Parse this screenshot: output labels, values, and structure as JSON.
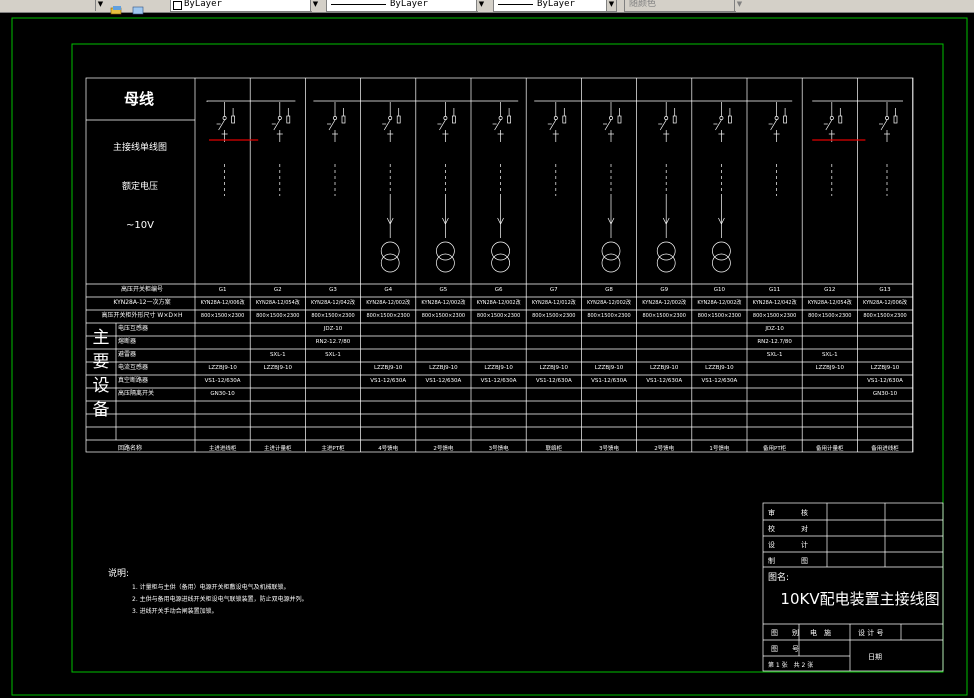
{
  "toolbar": {
    "dropdowns": [
      {
        "value": "ByLayer"
      },
      {
        "value": "ByLayer"
      },
      {
        "value": "ByLayer"
      },
      {
        "value": "随颜色"
      }
    ]
  },
  "drawing": {
    "busbar_title": "母线",
    "left_labels": {
      "diagram": "主接线单线图",
      "voltage_label": "额定电压",
      "voltage_value": "~10V"
    },
    "row_headers": {
      "cabinet_no": "高压开关柜编号",
      "cabinet_type": "KYN28A-12一次方案",
      "dims": "高压开关柜外形尺寸 W×D×H",
      "purpose": "回路名称"
    },
    "main_equipment_label": [
      "主",
      "要",
      "设",
      "备"
    ],
    "equipment_rows": [
      "电压互感器",
      "熔断器",
      "避雷器",
      "电流互感器",
      "真空断路器",
      "高压隔离开关"
    ],
    "columns": [
      {
        "no": "G1",
        "type": "KYN28A-12/006改",
        "dims": "800×1500×2300",
        "vt": "",
        "fuse": "",
        "arrester": "",
        "ct": "LZZBJ9-10",
        "breaker": "VS1-12/630A",
        "switch": "GN30-10",
        "purpose": "主进进线柜",
        "xformer": false
      },
      {
        "no": "G2",
        "type": "KYN28A-12/054改",
        "dims": "800×1500×2300",
        "vt": "",
        "fuse": "",
        "arrester": "SXL-1",
        "ct": "LZZBJ9-10",
        "breaker": "",
        "switch": "",
        "purpose": "主进计量柜",
        "xformer": false
      },
      {
        "no": "G3",
        "type": "KYN28A-12/042改",
        "dims": "800×1500×2300",
        "vt": "JDZ-10",
        "fuse": "RN2-12.7/80",
        "arrester": "SXL-1",
        "ct": "",
        "breaker": "",
        "switch": "",
        "purpose": "主进PT柜",
        "xformer": false
      },
      {
        "no": "G4",
        "type": "KYN28A-12/002改",
        "dims": "800×1500×2300",
        "vt": "",
        "fuse": "",
        "arrester": "",
        "ct": "LZZBJ9-10",
        "breaker": "VS1-12/630A",
        "switch": "",
        "purpose": "4号馈电",
        "xformer": true
      },
      {
        "no": "G5",
        "type": "KYN28A-12/002改",
        "dims": "800×1500×2300",
        "vt": "",
        "fuse": "",
        "arrester": "",
        "ct": "LZZBJ9-10",
        "breaker": "VS1-12/630A",
        "switch": "",
        "purpose": "2号馈电",
        "xformer": true
      },
      {
        "no": "G6",
        "type": "KYN28A-12/002改",
        "dims": "800×1500×2300",
        "vt": "",
        "fuse": "",
        "arrester": "",
        "ct": "LZZBJ9-10",
        "breaker": "VS1-12/630A",
        "switch": "",
        "purpose": "3号馈电",
        "xformer": true
      },
      {
        "no": "G7",
        "type": "KYN28A-12/012改",
        "dims": "800×1500×2300",
        "vt": "",
        "fuse": "",
        "arrester": "",
        "ct": "LZZBJ9-10",
        "breaker": "VS1-12/630A",
        "switch": "",
        "purpose": "联络柜",
        "xformer": false
      },
      {
        "no": "G8",
        "type": "KYN28A-12/002改",
        "dims": "800×1500×2300",
        "vt": "",
        "fuse": "",
        "arrester": "",
        "ct": "LZZBJ9-10",
        "breaker": "VS1-12/630A",
        "switch": "",
        "purpose": "3号馈电",
        "xformer": true
      },
      {
        "no": "G9",
        "type": "KYN28A-12/002改",
        "dims": "800×1500×2300",
        "vt": "",
        "fuse": "",
        "arrester": "",
        "ct": "LZZBJ9-10",
        "breaker": "VS1-12/630A",
        "switch": "",
        "purpose": "2号馈电",
        "xformer": true
      },
      {
        "no": "G10",
        "type": "KYN28A-12/002改",
        "dims": "800×1500×2300",
        "vt": "",
        "fuse": "",
        "arrester": "",
        "ct": "LZZBJ9-10",
        "breaker": "VS1-12/630A",
        "switch": "",
        "purpose": "1号馈电",
        "xformer": true
      },
      {
        "no": "G11",
        "type": "KYN28A-12/042改",
        "dims": "800×1500×2300",
        "vt": "JDZ-10",
        "fuse": "RN2-12.7/80",
        "arrester": "SXL-1",
        "ct": "",
        "breaker": "",
        "switch": "",
        "purpose": "备用PT柜",
        "xformer": false
      },
      {
        "no": "G12",
        "type": "KYN28A-12/054改",
        "dims": "800×1500×2300",
        "vt": "",
        "fuse": "",
        "arrester": "SXL-1",
        "ct": "LZZBJ9-10",
        "breaker": "",
        "switch": "",
        "purpose": "备用计量柜",
        "xformer": false
      },
      {
        "no": "G13",
        "type": "KYN28A-12/006改",
        "dims": "800×1500×2300",
        "vt": "",
        "fuse": "",
        "arrester": "",
        "ct": "LZZBJ9-10",
        "breaker": "VS1-12/630A",
        "switch": "GN30-10",
        "purpose": "备用进线柜",
        "xformer": false
      }
    ],
    "notes": {
      "heading": "说明:",
      "items": [
        "1. 计量柜与主供（备用）电源开关柜敷设电气及机械联锁。",
        "2. 主供与备用电源进线开关柜设电气联锁装置，防止双电源并列。",
        "3. 进线开关手动合闸装置加锁。"
      ]
    },
    "title_block": {
      "rows": [
        {
          "label": "审",
          "label2": "核"
        },
        {
          "label": "校",
          "label2": "对"
        },
        {
          "label": "设",
          "label2": "计"
        },
        {
          "label": "制",
          "label2": "图"
        }
      ],
      "name_label": "图名:",
      "drawing_title": "10KV配电装置主接线图",
      "drawing_category_label": "图　　别",
      "drawing_category": "电　施",
      "design_no_label": "设 计 号",
      "drawing_no_label": "图　　号",
      "date_label": "日期",
      "sheet_info": "第 1 张　共 2 张"
    }
  }
}
